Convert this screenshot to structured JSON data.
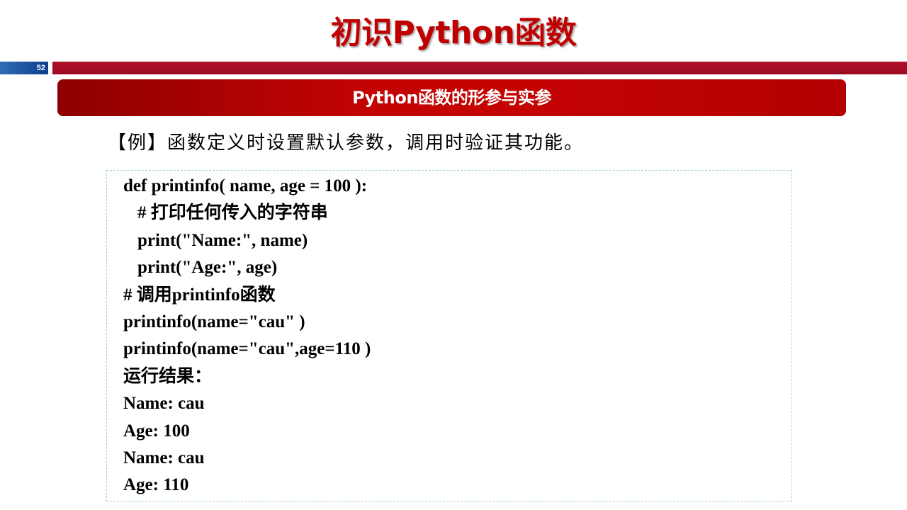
{
  "slide": {
    "title": "初识Python函数",
    "number": "52",
    "section_heading": "Python函数的形参与实参",
    "example_text": "【例】函数定义时设置默认参数，调用时验证其功能。"
  },
  "code": {
    "lines": [
      "def printinfo( name, age = 100 ):",
      "# 打印任何传入的字符串",
      "print(\"Name:\", name)",
      "print(\"Age:\", age)",
      "# 调用printinfo函数",
      "printinfo(name=\"cau\" )",
      "printinfo(name=\"cau\",age=110 )",
      "运行结果：",
      "Name: cau",
      "Age: 100",
      "Name: cau",
      "Age: 110"
    ]
  },
  "colors": {
    "title_red": "#c00000",
    "bar_red": "#a50d26",
    "number_blue": "#1f5aa6",
    "banner_red": "#c40303",
    "code_border": "#9fd6c4"
  }
}
